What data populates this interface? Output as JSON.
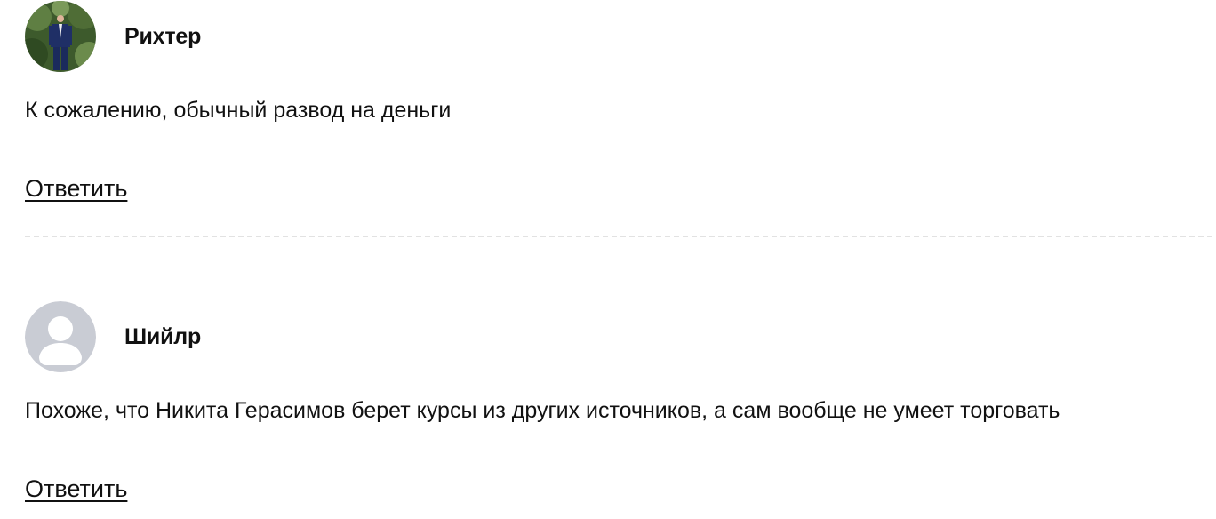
{
  "comments": [
    {
      "author": "Рихтер",
      "avatar_icon": "user-photo-avatar",
      "text": "К сожалению, обычный развод на деньги",
      "reply_label": "Ответить"
    },
    {
      "author": "Шийлр",
      "avatar_icon": "default-user-avatar-icon",
      "text": "Похоже, что Никита Герасимов берет курсы из других источников, а сам вообще не умеет торговать",
      "reply_label": "Ответить"
    }
  ],
  "colors": {
    "text": "#111111",
    "divider": "#e2e2e2",
    "default_avatar_bg": "#c9ccd4",
    "default_avatar_fg": "#ffffff"
  }
}
